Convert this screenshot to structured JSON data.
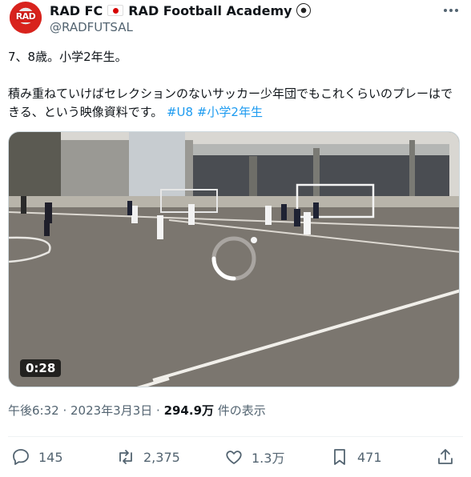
{
  "author": {
    "display_name": "RAD FC",
    "display_name_suffix": "RAD Football Academy",
    "handle": "@RADFUTSAL",
    "avatar_text": "RAD",
    "flag_icon": "japan-flag-icon",
    "ball_icon": "soccer-ball-icon"
  },
  "tweet": {
    "line1": "7、8歳。小学2年生。",
    "line2": "積み重ねていけばセレクションのないサッカー少年団でもこれくらいのプレーはできる、という映像資料です。",
    "hashtags": [
      "#U8",
      "#小学2年生"
    ]
  },
  "media": {
    "duration": "0:28"
  },
  "meta": {
    "timestamp": "午後6:32 · 2023年3月3日 · ",
    "views_count": "294.9万",
    "views_label": " 件の表示"
  },
  "actions": {
    "reply_count": "145",
    "retweet_count": "2,375",
    "like_count": "1.3万",
    "bookmark_count": "471"
  },
  "colors": {
    "accent": "#1d9bf0",
    "secondary_text": "#536471",
    "avatar_red": "#d8231d"
  }
}
